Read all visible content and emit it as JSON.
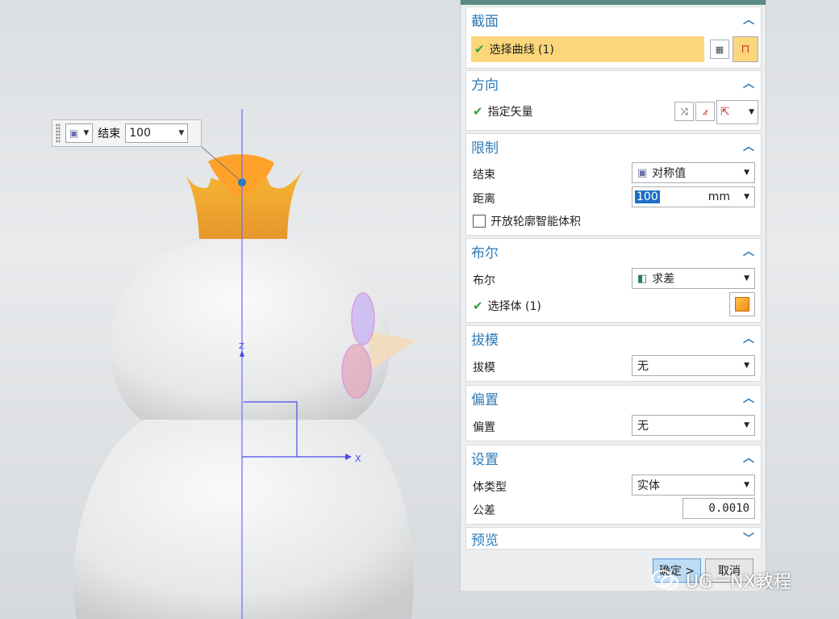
{
  "viewport": {
    "mini_toolbar": {
      "end_label": "结束",
      "end_value": "100"
    },
    "axes": {
      "x_label": "X",
      "z_label": "Z"
    }
  },
  "dialog": {
    "section": {
      "title": "截面",
      "select_curve": "选择曲线 (1)"
    },
    "direction": {
      "title": "方向",
      "specify_vector": "指定矢量"
    },
    "limits": {
      "title": "限制",
      "end_label": "结束",
      "end_value": "对称值",
      "distance_label": "距离",
      "distance_value": "100",
      "distance_unit": "mm",
      "open_profile_label": "开放轮廓智能体积"
    },
    "boolean": {
      "title": "布尔",
      "boolean_label": "布尔",
      "boolean_value": "求差",
      "select_body": "选择体 (1)"
    },
    "draft": {
      "title": "拔模",
      "draft_label": "拔模",
      "draft_value": "无"
    },
    "offset": {
      "title": "偏置",
      "offset_label": "偏置",
      "offset_value": "无"
    },
    "settings": {
      "title": "设置",
      "body_type_label": "体类型",
      "body_type_value": "实体",
      "tolerance_label": "公差",
      "tolerance_value": "0.0010"
    },
    "preview": {
      "title": "预览"
    },
    "buttons": {
      "ok": "确定 >",
      "cancel": "取消"
    }
  },
  "watermark": {
    "text": "UG一NX教程"
  },
  "colors": {
    "accent": "#2e7bb8",
    "highlight": "#fcd67a",
    "check": "#2ea33a",
    "crown": "#f5a623"
  }
}
